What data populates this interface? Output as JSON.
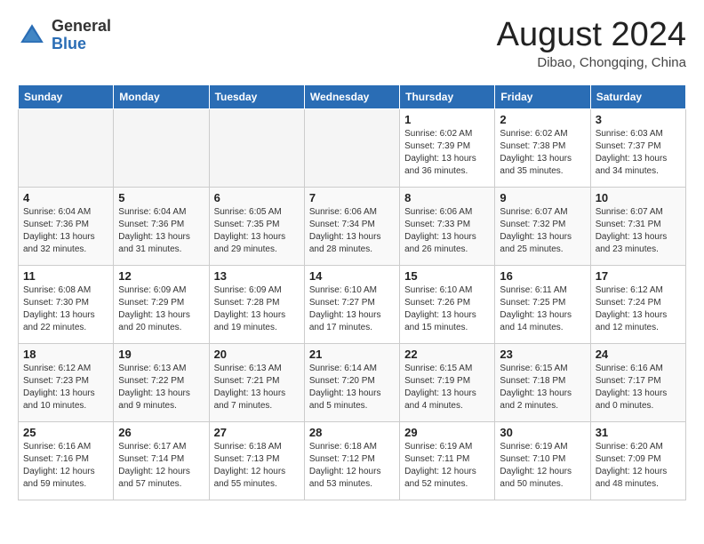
{
  "header": {
    "logo_line1": "General",
    "logo_line2": "Blue",
    "month_year": "August 2024",
    "location": "Dibao, Chongqing, China"
  },
  "weekdays": [
    "Sunday",
    "Monday",
    "Tuesday",
    "Wednesday",
    "Thursday",
    "Friday",
    "Saturday"
  ],
  "weeks": [
    [
      {
        "day": "",
        "info": ""
      },
      {
        "day": "",
        "info": ""
      },
      {
        "day": "",
        "info": ""
      },
      {
        "day": "",
        "info": ""
      },
      {
        "day": "1",
        "info": "Sunrise: 6:02 AM\nSunset: 7:39 PM\nDaylight: 13 hours\nand 36 minutes."
      },
      {
        "day": "2",
        "info": "Sunrise: 6:02 AM\nSunset: 7:38 PM\nDaylight: 13 hours\nand 35 minutes."
      },
      {
        "day": "3",
        "info": "Sunrise: 6:03 AM\nSunset: 7:37 PM\nDaylight: 13 hours\nand 34 minutes."
      }
    ],
    [
      {
        "day": "4",
        "info": "Sunrise: 6:04 AM\nSunset: 7:36 PM\nDaylight: 13 hours\nand 32 minutes."
      },
      {
        "day": "5",
        "info": "Sunrise: 6:04 AM\nSunset: 7:36 PM\nDaylight: 13 hours\nand 31 minutes."
      },
      {
        "day": "6",
        "info": "Sunrise: 6:05 AM\nSunset: 7:35 PM\nDaylight: 13 hours\nand 29 minutes."
      },
      {
        "day": "7",
        "info": "Sunrise: 6:06 AM\nSunset: 7:34 PM\nDaylight: 13 hours\nand 28 minutes."
      },
      {
        "day": "8",
        "info": "Sunrise: 6:06 AM\nSunset: 7:33 PM\nDaylight: 13 hours\nand 26 minutes."
      },
      {
        "day": "9",
        "info": "Sunrise: 6:07 AM\nSunset: 7:32 PM\nDaylight: 13 hours\nand 25 minutes."
      },
      {
        "day": "10",
        "info": "Sunrise: 6:07 AM\nSunset: 7:31 PM\nDaylight: 13 hours\nand 23 minutes."
      }
    ],
    [
      {
        "day": "11",
        "info": "Sunrise: 6:08 AM\nSunset: 7:30 PM\nDaylight: 13 hours\nand 22 minutes."
      },
      {
        "day": "12",
        "info": "Sunrise: 6:09 AM\nSunset: 7:29 PM\nDaylight: 13 hours\nand 20 minutes."
      },
      {
        "day": "13",
        "info": "Sunrise: 6:09 AM\nSunset: 7:28 PM\nDaylight: 13 hours\nand 19 minutes."
      },
      {
        "day": "14",
        "info": "Sunrise: 6:10 AM\nSunset: 7:27 PM\nDaylight: 13 hours\nand 17 minutes."
      },
      {
        "day": "15",
        "info": "Sunrise: 6:10 AM\nSunset: 7:26 PM\nDaylight: 13 hours\nand 15 minutes."
      },
      {
        "day": "16",
        "info": "Sunrise: 6:11 AM\nSunset: 7:25 PM\nDaylight: 13 hours\nand 14 minutes."
      },
      {
        "day": "17",
        "info": "Sunrise: 6:12 AM\nSunset: 7:24 PM\nDaylight: 13 hours\nand 12 minutes."
      }
    ],
    [
      {
        "day": "18",
        "info": "Sunrise: 6:12 AM\nSunset: 7:23 PM\nDaylight: 13 hours\nand 10 minutes."
      },
      {
        "day": "19",
        "info": "Sunrise: 6:13 AM\nSunset: 7:22 PM\nDaylight: 13 hours\nand 9 minutes."
      },
      {
        "day": "20",
        "info": "Sunrise: 6:13 AM\nSunset: 7:21 PM\nDaylight: 13 hours\nand 7 minutes."
      },
      {
        "day": "21",
        "info": "Sunrise: 6:14 AM\nSunset: 7:20 PM\nDaylight: 13 hours\nand 5 minutes."
      },
      {
        "day": "22",
        "info": "Sunrise: 6:15 AM\nSunset: 7:19 PM\nDaylight: 13 hours\nand 4 minutes."
      },
      {
        "day": "23",
        "info": "Sunrise: 6:15 AM\nSunset: 7:18 PM\nDaylight: 13 hours\nand 2 minutes."
      },
      {
        "day": "24",
        "info": "Sunrise: 6:16 AM\nSunset: 7:17 PM\nDaylight: 13 hours\nand 0 minutes."
      }
    ],
    [
      {
        "day": "25",
        "info": "Sunrise: 6:16 AM\nSunset: 7:16 PM\nDaylight: 12 hours\nand 59 minutes."
      },
      {
        "day": "26",
        "info": "Sunrise: 6:17 AM\nSunset: 7:14 PM\nDaylight: 12 hours\nand 57 minutes."
      },
      {
        "day": "27",
        "info": "Sunrise: 6:18 AM\nSunset: 7:13 PM\nDaylight: 12 hours\nand 55 minutes."
      },
      {
        "day": "28",
        "info": "Sunrise: 6:18 AM\nSunset: 7:12 PM\nDaylight: 12 hours\nand 53 minutes."
      },
      {
        "day": "29",
        "info": "Sunrise: 6:19 AM\nSunset: 7:11 PM\nDaylight: 12 hours\nand 52 minutes."
      },
      {
        "day": "30",
        "info": "Sunrise: 6:19 AM\nSunset: 7:10 PM\nDaylight: 12 hours\nand 50 minutes."
      },
      {
        "day": "31",
        "info": "Sunrise: 6:20 AM\nSunset: 7:09 PM\nDaylight: 12 hours\nand 48 minutes."
      }
    ]
  ]
}
